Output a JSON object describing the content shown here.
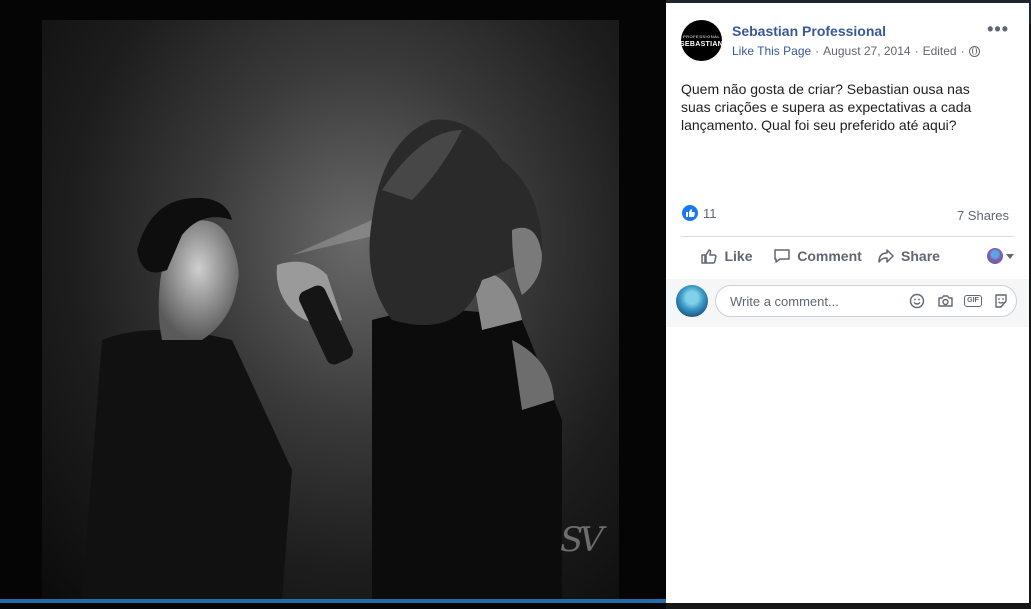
{
  "post": {
    "page_name": "Sebastian Professional",
    "avatar_text": "SEBASTIAN",
    "avatar_subtext": "PROFESSIONAL",
    "like_link": "Like This Page",
    "separator": "·",
    "date": "August 27, 2014",
    "edited": "Edited",
    "more_icon": "•••",
    "text": "Quem não gosta de criar? Sebastian ousa nas suas criações e supera as expectativas a cada lançamento. Qual foi seu preferido até aqui?",
    "reaction_count": "11",
    "shares": "7 Shares"
  },
  "actions": {
    "like": "Like",
    "comment": "Comment",
    "share": "Share"
  },
  "comment": {
    "placeholder": "Write a comment..."
  },
  "photo": {
    "signature": "SV"
  },
  "colors": {
    "accent": "#385898",
    "like_blue": "#1877f2"
  }
}
